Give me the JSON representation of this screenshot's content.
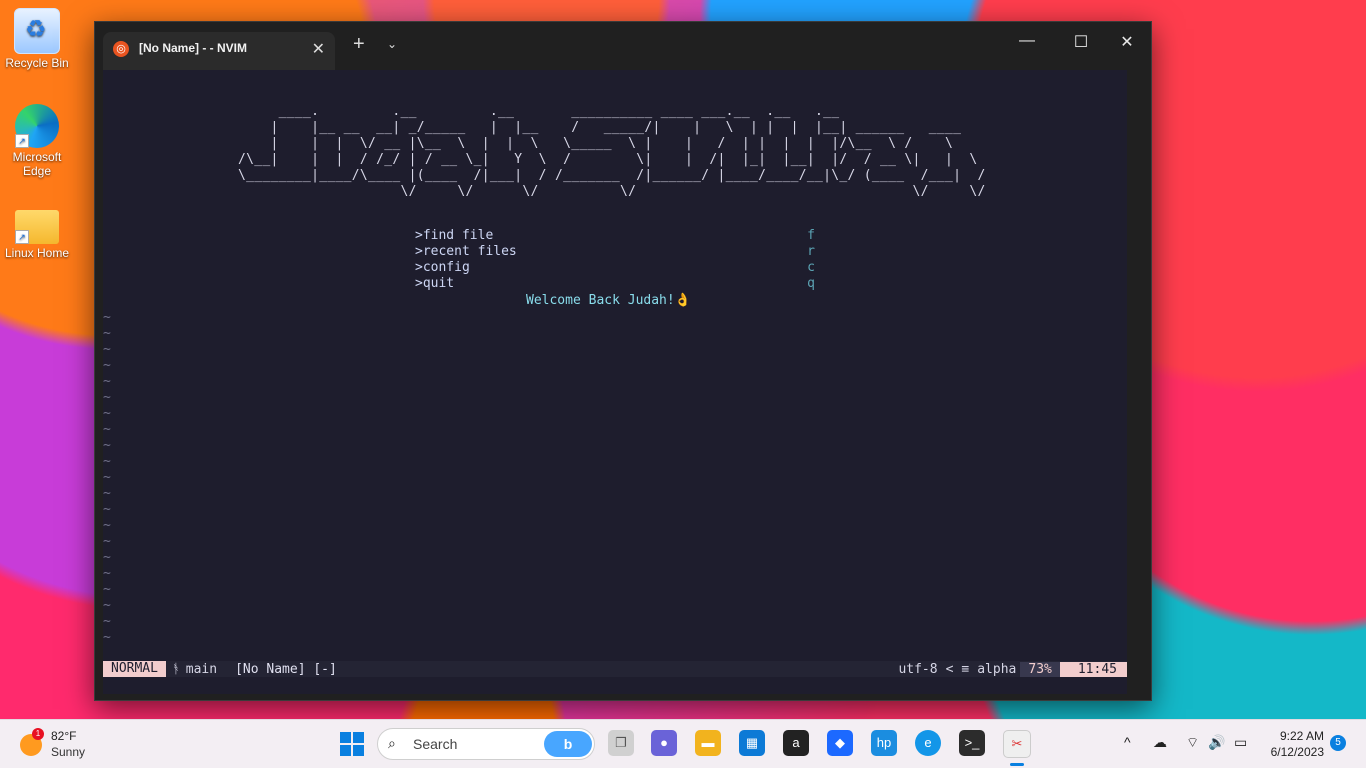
{
  "desktop": {
    "icons": [
      {
        "label": "Recycle Bin"
      },
      {
        "label": "Microsoft Edge"
      },
      {
        "label": "Linux Home"
      }
    ]
  },
  "window": {
    "tab_title": "[No Name] - - NVIM",
    "new_tab": "+",
    "tab_dropdown": "⌄",
    "close_tab": "✕",
    "minimize": "—",
    "maximize": "☐",
    "close": "✕"
  },
  "nvim": {
    "banner": "     ____.         .__         .__       __________ ____ ___.__  .__   .__                \n    |    |__ __  __| _/_____   |  |__    /   _____/|    |   \\  | |  |  |__| ______   ____   \n    |    |  |  \\/ __ |\\__  \\  |  |  \\   \\_____  \\ |    |   /  | |  |  |  |/\\__  \\ /    \\  \n/\\__|    |  |  / /_/ | / __ \\_|   Y  \\  /        \\|    |  /|  |_|  |__|  |/  / __ \\|   |  \\ \n\\________|____/\\____ |(____  /|___|  / /_______  /|______/ |____/____/__|\\_/ (____  /___|  / \n                    \\/     \\/      \\/          \\/                                  \\/     \\/  ",
    "menu": [
      {
        "label": ">find file",
        "key": "f"
      },
      {
        "label": ">recent files",
        "key": "r"
      },
      {
        "label": ">config",
        "key": "c"
      },
      {
        "label": ">quit",
        "key": "q"
      }
    ],
    "welcome": "Welcome Back Judah!👌",
    "tilde_line": "~",
    "status": {
      "mode": "NORMAL",
      "branch_icon": "ᚬ",
      "branch": "main",
      "file": "[No Name] [-]",
      "encoding": "utf-8",
      "separator": "<",
      "format_icon": "≡",
      "filetype": "alpha",
      "percent": "73%",
      "position": "11:45"
    }
  },
  "taskbar": {
    "weather": {
      "badge": "1",
      "temp": "82°F",
      "condition": "Sunny"
    },
    "search_placeholder": "Search",
    "search_icon": "search-icon",
    "bing_label": "b",
    "apps": [
      {
        "name": "task-view",
        "glyph": "❐",
        "color": "#6b6b6b"
      },
      {
        "name": "teams-chat",
        "glyph": "●",
        "color": "#6a63d8"
      },
      {
        "name": "file-explorer",
        "glyph": "▬",
        "color": "#f2b31e"
      },
      {
        "name": "microsoft-store",
        "glyph": "▦",
        "color": "#0c7ad6"
      },
      {
        "name": "amazon",
        "glyph": "a",
        "color": "#ffffff"
      },
      {
        "name": "dropbox",
        "glyph": "◆",
        "color": "#1c69ff"
      },
      {
        "name": "myhp",
        "glyph": "hp",
        "color": "#1b8de0"
      },
      {
        "name": "edge",
        "glyph": "e",
        "color": "#1396e8"
      },
      {
        "name": "terminal",
        "glyph": ">_",
        "color": "#2c2c2c"
      },
      {
        "name": "snipping-tool",
        "glyph": "✂",
        "color": "#efefef"
      }
    ],
    "tray": {
      "chevron": "^",
      "onedrive": "☁",
      "wifi": "⌔",
      "volume": "🔊",
      "battery": "▭"
    },
    "time": "9:22 AM",
    "date": "6/12/2023",
    "notifications": "5"
  }
}
